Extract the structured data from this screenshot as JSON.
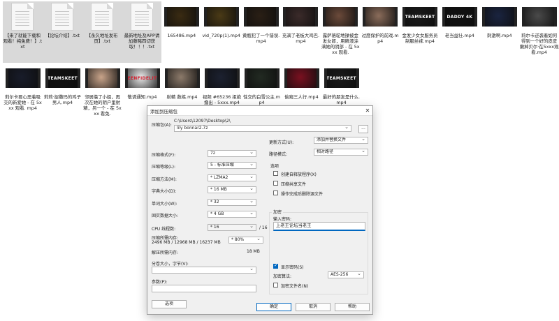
{
  "files_row1": [
    {
      "type": "doc",
      "name": "【来了就能下载和观看！纯免费！】.txt",
      "selected": true
    },
    {
      "type": "doc",
      "name": "【论坛介绍】.txt",
      "selected": true
    },
    {
      "type": "doc",
      "name": "【永久地址发布页】.txt",
      "selected": true
    },
    {
      "type": "doc",
      "name": "最新地址及APP请加藤赌四切获取！！！.txt",
      "selected": true
    },
    {
      "type": "vid",
      "name": "165486.mp4",
      "brand": "",
      "bg": "#3a2b12"
    },
    {
      "type": "vid",
      "name": "vid_720p(1).mp4",
      "brand": "",
      "bg": "#4a3a16"
    },
    {
      "type": "vid",
      "name": "黄瓶犯了一个错误.mp4",
      "brand": "",
      "bg": "#2a1f15"
    },
    {
      "type": "vid",
      "name": "充满了老板大鸡巴.mp4",
      "brand": "",
      "bg": "#3b2b2a"
    },
    {
      "type": "vid",
      "name": "露萨骆驼地操被金发女郎，用精液涂满她的阴部 - 在 5xxx 观看.",
      "brand": "",
      "bg": "#6b4a3a"
    },
    {
      "type": "vid",
      "name": "过度保护的前戏.mp4",
      "brand": "",
      "bg": "#8a6c5a"
    },
    {
      "type": "vid",
      "name": "金发少女女服务员制服丝袜.mp4",
      "brand": "TEAMSKEET",
      "bg": "#1a1a1a"
    },
    {
      "type": "vid",
      "name": "老当益壮.mp4",
      "brand": "DADDY 4K",
      "bg": "#111111"
    },
    {
      "type": "vid",
      "name": "刺激啊.mp4",
      "brand": "",
      "bg": "#1a2440"
    },
    {
      "type": "vid",
      "name": "莉尔卡逆袭着如何得到一个好的皮皮嫩掉贝尔·在5xxx观看.mp4",
      "brand": "",
      "bg": "#4a4a4a"
    }
  ],
  "files_row2": [
    {
      "type": "vid",
      "name": "莉尔卡要心思着吸交的新爱她 - 在 5xxx 观看. mp4",
      "brand": "",
      "bg": "#181c2a"
    },
    {
      "type": "vid",
      "name": "莉莉·捉撒玛的鸡子男人.mp4",
      "brand": "TEAMSKEET",
      "bg": "#111111"
    },
    {
      "type": "vid",
      "name": "邻居撸了小姐，再次在她的阴户里射精，另一个 - 在 5xxx 看免.",
      "brand": "",
      "bg": "#c9a48a"
    },
    {
      "type": "vid",
      "name": "敬请通知.mp4",
      "brand": "TEENFIDELITY",
      "bg": "#e9e9e9"
    },
    {
      "type": "vid",
      "name": "射精 数练.mp4",
      "brand": "",
      "bg": "#8c7a6a"
    },
    {
      "type": "vid",
      "name": "视频 #65236 拒绝撸出 - 5xxx.mp4",
      "brand": "",
      "bg": "#1c2130"
    },
    {
      "type": "vid",
      "name": "性交的白雪公主.mp4",
      "brand": "",
      "bg": "#222a22"
    },
    {
      "type": "vid",
      "name": "偷窥三人行.mp4",
      "brand": "",
      "bg": "#7a1020"
    },
    {
      "type": "vid",
      "name": "最好的朋友是什么.mp4",
      "brand": "TEAMSKEET",
      "bg": "#1a1a1a"
    }
  ],
  "dialog": {
    "title": "添加到压缩包",
    "archive_label": "压缩包(A):",
    "archive_path": "C:\\Users\\12097\\Desktop\\2\\",
    "archive_name": "lily bonnar2.7z",
    "browse_label": "...",
    "left": [
      {
        "label": "压缩格式(F):",
        "value": "7z"
      },
      {
        "label": "压缩等级(L):",
        "value": "5 - 标准压缩"
      },
      {
        "label": "压缩方法(M):",
        "value": "* LZMA2"
      },
      {
        "label": "字典大小(D):",
        "value": "* 16 MB"
      },
      {
        "label": "单词大小(W):",
        "value": "* 32"
      },
      {
        "label": "固实数据大小:",
        "value": "* 4 GB"
      },
      {
        "label": "CPU 线程数:",
        "value": "* 16",
        "suffix": "/ 16"
      }
    ],
    "memory_label": "压缩所需内存:",
    "memory_detail": "2496 MB / 12968 MB / 16237 MB",
    "memory_percent": "* 80%",
    "decompress_label": "解压所需内存:",
    "decompress_value": "18 MB",
    "split_label": "分卷大小，字节(V):",
    "params_label": "参数(P):",
    "options_button": "选项",
    "update_label": "更新方式(U):",
    "update_value": "添加并替换文件",
    "path_label": "路径模式:",
    "path_value": "相对路径",
    "options_group": "选项",
    "opt_sfx": "创建自释放程序(X)",
    "opt_shared": "压缩共享文件",
    "opt_delete": "操作完成后删除源文件",
    "encrypt_group": "加密",
    "password_label": "输入密码:",
    "password_value": "上老王论坛当老王",
    "show_password": "显示密码(S)",
    "encrypt_method_label": "加密算法:",
    "encrypt_method_value": "AES-256",
    "encrypt_names": "加密文件名(N)",
    "ok": "确定",
    "cancel": "取消",
    "help": "帮助"
  }
}
